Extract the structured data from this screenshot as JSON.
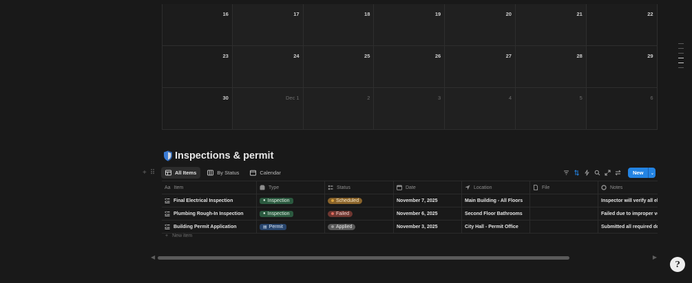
{
  "calendar": {
    "weeks": [
      {
        "days": [
          {
            "label": "16",
            "other": false,
            "weekend": true
          },
          {
            "label": "17",
            "other": false,
            "weekend": false
          },
          {
            "label": "18",
            "other": false,
            "weekend": false
          },
          {
            "label": "19",
            "other": false,
            "weekend": false
          },
          {
            "label": "20",
            "other": false,
            "weekend": false
          },
          {
            "label": "21",
            "other": false,
            "weekend": false
          },
          {
            "label": "22",
            "other": false,
            "weekend": true
          }
        ]
      },
      {
        "days": [
          {
            "label": "23",
            "other": false,
            "weekend": true
          },
          {
            "label": "24",
            "other": false,
            "weekend": false
          },
          {
            "label": "25",
            "other": false,
            "weekend": false
          },
          {
            "label": "26",
            "other": false,
            "weekend": false
          },
          {
            "label": "27",
            "other": false,
            "weekend": false
          },
          {
            "label": "28",
            "other": false,
            "weekend": false
          },
          {
            "label": "29",
            "other": false,
            "weekend": true
          }
        ]
      },
      {
        "days": [
          {
            "label": "30",
            "other": false,
            "weekend": true
          },
          {
            "label": "Dec 1",
            "other": true,
            "weekend": false
          },
          {
            "label": "2",
            "other": true,
            "weekend": false
          },
          {
            "label": "3",
            "other": true,
            "weekend": false
          },
          {
            "label": "4",
            "other": true,
            "weekend": false
          },
          {
            "label": "5",
            "other": true,
            "weekend": false
          },
          {
            "label": "6",
            "other": true,
            "weekend": true
          }
        ]
      }
    ]
  },
  "database": {
    "title": "Inspections & permit",
    "icon": "shield-icon",
    "views": [
      {
        "label": "All Items",
        "icon": "table-icon",
        "active": true
      },
      {
        "label": "By Status",
        "icon": "board-icon",
        "active": false
      },
      {
        "label": "Calendar",
        "icon": "calendar-icon",
        "active": false
      }
    ],
    "toolbar": {
      "icons": [
        "filter-icon",
        "sort-icon",
        "automation-icon",
        "search-icon",
        "expand-icon",
        "settings-icon"
      ],
      "new_label": "New",
      "accent": "#2383e2"
    },
    "columns": [
      {
        "label": "Item",
        "icon": "text-property-icon"
      },
      {
        "label": "Type",
        "icon": "select-icon"
      },
      {
        "label": "Status",
        "icon": "status-icon"
      },
      {
        "label": "Date",
        "icon": "calendar-icon"
      },
      {
        "label": "Location",
        "icon": "location-icon"
      },
      {
        "label": "File",
        "icon": "file-icon"
      },
      {
        "label": "Notes",
        "icon": "notes-icon"
      }
    ],
    "rows": [
      {
        "item": "Final Electrical Inspection",
        "type": "Inspection",
        "type_icon": "magnifier-icon",
        "status": "Scheduled",
        "status_color": "#d9a33f",
        "date": "November 7, 2025",
        "location": "Main Building - All Floors",
        "file": "",
        "notes": "Inspector will verify all electrical work"
      },
      {
        "item": "Plumbing Rough-In Inspection",
        "type": "Inspection",
        "type_icon": "magnifier-icon",
        "status": "Failed",
        "status_color": "#e06b5f",
        "date": "November 6, 2025",
        "location": "Second Floor Bathrooms",
        "file": "",
        "notes": "Failed due to improper venting"
      },
      {
        "item": "Building Permit Application",
        "type": "Permit",
        "type_icon": "document-icon",
        "status": "Applied",
        "status_color": "#9b9b9b",
        "date": "November 3, 2025",
        "location": "City Hall - Permit Office",
        "file": "",
        "notes": "Submitted all required documents"
      }
    ],
    "new_item_label": "New item"
  },
  "help": {
    "label": "?"
  }
}
